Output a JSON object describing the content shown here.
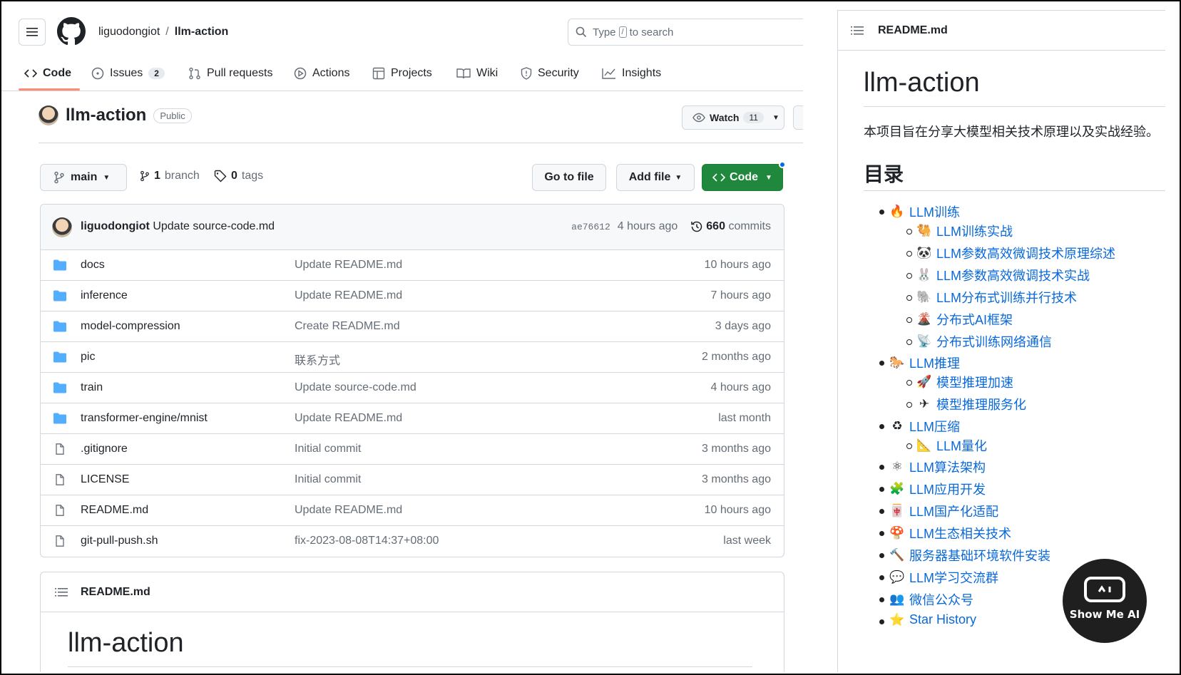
{
  "header": {
    "owner": "liguodongiot",
    "separator": "/",
    "repo": "llm-action",
    "search_pre": "Type",
    "search_key": "/",
    "search_post": "to search"
  },
  "tabs": [
    {
      "label": "Code",
      "icon": "code-icon"
    },
    {
      "label": "Issues",
      "icon": "issue-icon",
      "count": "2"
    },
    {
      "label": "Pull requests",
      "icon": "pull-request-icon"
    },
    {
      "label": "Actions",
      "icon": "play-icon"
    },
    {
      "label": "Projects",
      "icon": "table-icon"
    },
    {
      "label": "Wiki",
      "icon": "book-icon"
    },
    {
      "label": "Security",
      "icon": "shield-icon"
    },
    {
      "label": "Insights",
      "icon": "graph-icon"
    }
  ],
  "repo_head": {
    "title": "llm-action",
    "visibility": "Public",
    "watch_label": "Watch",
    "watch_count": "11"
  },
  "toolbar": {
    "branch": "main",
    "branches_count": "1",
    "branches_label": "branch",
    "tags_count": "0",
    "tags_label": "tags",
    "go_to_file": "Go to file",
    "add_file": "Add file",
    "code": "Code"
  },
  "commit": {
    "author": "liguodongiot",
    "message": "Update source-code.md",
    "sha": "ae76612",
    "time": "4 hours ago",
    "commits_count": "660",
    "commits_label": "commits"
  },
  "files": [
    {
      "name": "docs",
      "type": "dir",
      "message": "Update README.md",
      "age": "10 hours ago"
    },
    {
      "name": "inference",
      "type": "dir",
      "message": "Update README.md",
      "age": "7 hours ago"
    },
    {
      "name": "model-compression",
      "type": "dir",
      "message": "Create README.md",
      "age": "3 days ago"
    },
    {
      "name": "pic",
      "type": "dir",
      "message": "联系方式",
      "age": "2 months ago"
    },
    {
      "name": "train",
      "type": "dir",
      "message": "Update source-code.md",
      "age": "4 hours ago"
    },
    {
      "name": "transformer-engine/mnist",
      "type": "dir",
      "message": "Update README.md",
      "age": "last month"
    },
    {
      "name": ".gitignore",
      "type": "file",
      "message": "Initial commit",
      "age": "3 months ago"
    },
    {
      "name": "LICENSE",
      "type": "file",
      "message": "Initial commit",
      "age": "3 months ago"
    },
    {
      "name": "README.md",
      "type": "file",
      "message": "Update README.md",
      "age": "10 hours ago"
    },
    {
      "name": "git-pull-push.sh",
      "type": "file",
      "message": "fix-2023-08-08T14:37+08:00",
      "age": "last week"
    }
  ],
  "readme": {
    "filename": "README.md",
    "title": "llm-action"
  },
  "panel": {
    "filename": "README.md",
    "title": "llm-action",
    "description": "本项目旨在分享大模型相关技术原理以及实战经验。",
    "toc_heading": "目录",
    "items": [
      {
        "emoji": "🔥",
        "label": "LLM训练",
        "level": 1
      },
      {
        "emoji": "🐫",
        "label": "LLM训练实战",
        "level": 2
      },
      {
        "emoji": "🐼",
        "label": "LLM参数高效微调技术原理综述",
        "level": 2
      },
      {
        "emoji": "🐰",
        "label": "LLM参数高效微调技术实战",
        "level": 2
      },
      {
        "emoji": "🐘",
        "label": "LLM分布式训练并行技术",
        "level": 2
      },
      {
        "emoji": "🌋",
        "label": "分布式AI框架",
        "level": 2
      },
      {
        "emoji": "📡",
        "label": "分布式训练网络通信",
        "level": 2
      },
      {
        "emoji": "🐎",
        "label": "LLM推理",
        "level": 1
      },
      {
        "emoji": "🚀",
        "label": "模型推理加速",
        "level": 2
      },
      {
        "emoji": "✈",
        "label": "模型推理服务化",
        "level": 2
      },
      {
        "emoji": "♻",
        "label": "LLM压缩",
        "level": 1
      },
      {
        "emoji": "📐",
        "label": "LLM量化",
        "level": 2
      },
      {
        "emoji": "⚛",
        "label": "LLM算法架构",
        "level": 1
      },
      {
        "emoji": "🧩",
        "label": "LLM应用开发",
        "level": 1
      },
      {
        "emoji": "🀄",
        "label": "LLM国产化适配",
        "level": 1
      },
      {
        "emoji": "🍄",
        "label": "LLM生态相关技术",
        "level": 1
      },
      {
        "emoji": "🔨",
        "label": "服务器基础环境软件安装",
        "level": 1
      },
      {
        "emoji": "💬",
        "label": "LLM学习交流群",
        "level": 1
      },
      {
        "emoji": "👥",
        "label": "微信公众号",
        "level": 1
      },
      {
        "emoji": "⭐",
        "label": "Star History",
        "level": 1
      }
    ]
  },
  "watermark": {
    "text": "Show Me AI"
  },
  "colors": {
    "link": "#0969da",
    "accent_green": "#1f883d",
    "tab_underline": "#fd8c73",
    "folder": "#54aeff"
  }
}
